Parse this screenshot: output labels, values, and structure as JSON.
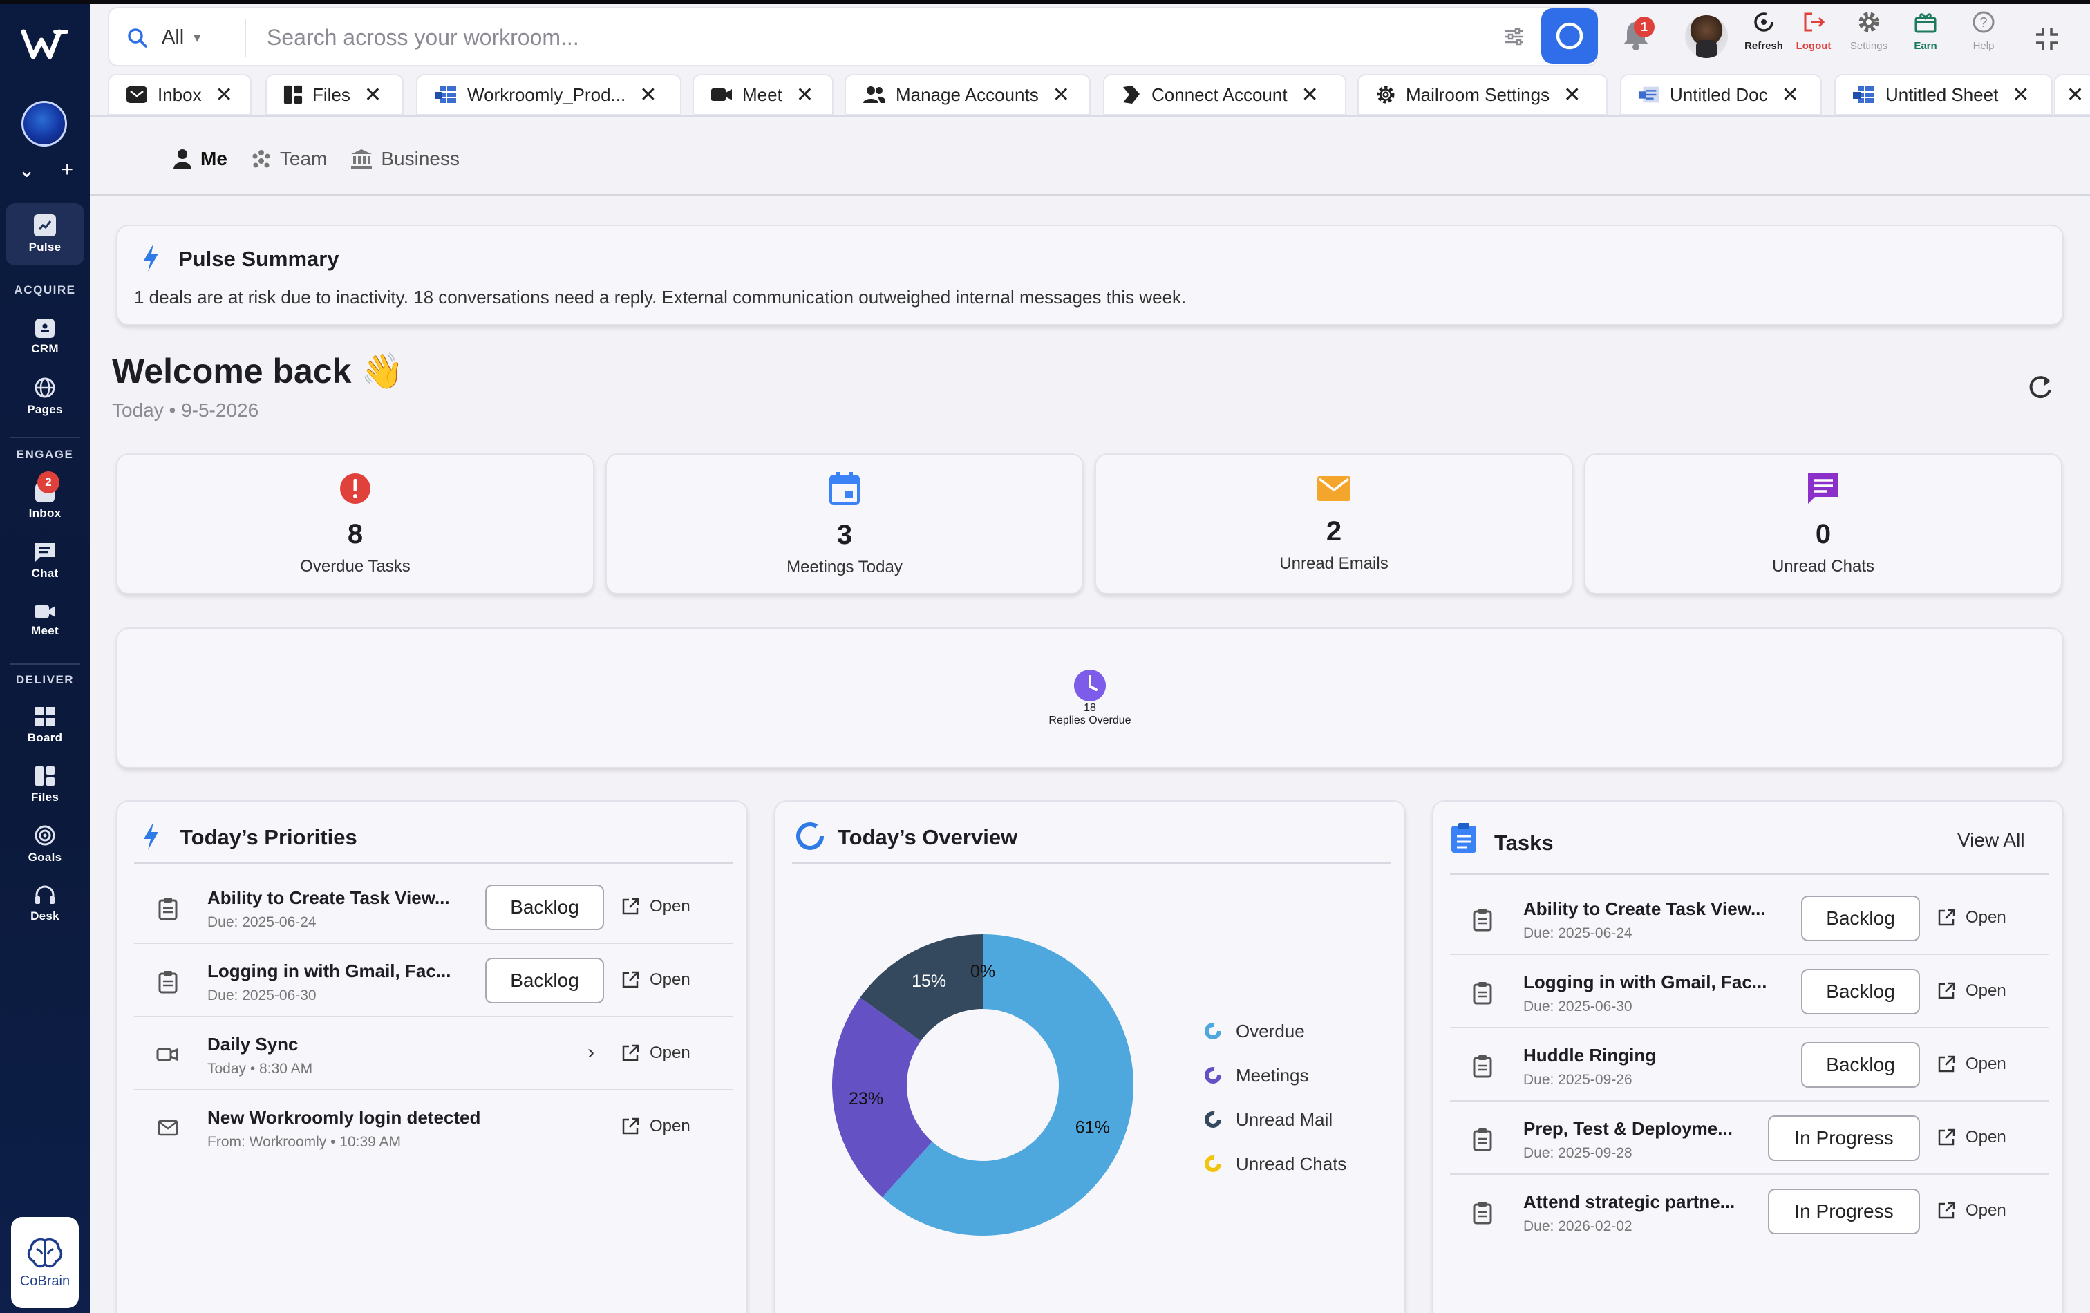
{
  "sidebar": {
    "items": {
      "pulse": "Pulse",
      "crm": "CRM",
      "pages": "Pages",
      "inbox": "Inbox",
      "chat": "Chat",
      "meet": "Meet",
      "board": "Board",
      "files": "Files",
      "goals": "Goals",
      "desk": "Desk"
    },
    "sections": {
      "acquire": "ACQUIRE",
      "engage": "ENGAGE",
      "deliver": "DELIVER"
    },
    "inbox_badge": "2",
    "cobrain": "CoBrain"
  },
  "search": {
    "scope": "All",
    "placeholder": "Search across your workroom..."
  },
  "topbar": {
    "notification_count": "1",
    "refresh": "Refresh",
    "logout": "Logout",
    "settings": "Settings",
    "earn": "Earn",
    "help": "Help"
  },
  "tabs": [
    {
      "label": "Inbox",
      "icon": "inbox-icon"
    },
    {
      "label": "Files",
      "icon": "files-icon"
    },
    {
      "label": "Workroomly_Prod...",
      "icon": "sheet-icon"
    },
    {
      "label": "Meet",
      "icon": "video-icon"
    },
    {
      "label": "Manage Accounts",
      "icon": "users-icon"
    },
    {
      "label": "Connect Account",
      "icon": "connect-icon"
    },
    {
      "label": "Mailroom Settings",
      "icon": "gear-icon"
    },
    {
      "label": "Untitled Doc",
      "icon": "doc-icon"
    },
    {
      "label": "Untitled Sheet",
      "icon": "sheet-icon"
    }
  ],
  "subnav": {
    "me": "Me",
    "team": "Team",
    "business": "Business"
  },
  "pulse": {
    "title": "Pulse Summary",
    "text": "1 deals are at risk due to inactivity. 18 conversations need a reply. External communication outweighed internal messages this week."
  },
  "welcome": {
    "title": "Welcome back 👋",
    "date": "Today • 9-5-2026"
  },
  "stats": [
    {
      "value": "8",
      "label": "Overdue Tasks",
      "color": "#e0413a"
    },
    {
      "value": "3",
      "label": "Meetings Today",
      "color": "#3b82f6"
    },
    {
      "value": "2",
      "label": "Unread Emails",
      "color": "#f3a62b"
    },
    {
      "value": "0",
      "label": "Unread Chats",
      "color": "#8b30c9"
    },
    {
      "value": "18",
      "label": "Replies Overdue",
      "color": "#7c5ce8"
    }
  ],
  "priorities": {
    "title": "Today’s Priorities",
    "open_label": "Open",
    "items": [
      {
        "title": "Ability to Create Task View...",
        "sub": "Due: 2025-06-24",
        "status": "Backlog"
      },
      {
        "title": "Logging in with Gmail, Fac...",
        "sub": "Due: 2025-06-30",
        "status": "Backlog"
      },
      {
        "title": "Daily Sync",
        "sub": "Today • 8:30 AM",
        "status": ""
      },
      {
        "title": "New Workroomly login detected",
        "sub": "From: Workroomly • 10:39 AM",
        "status": ""
      }
    ]
  },
  "overview": {
    "title": "Today’s Overview"
  },
  "chart_data": {
    "type": "pie",
    "title": "Today’s Overview",
    "categories": [
      "Overdue",
      "Meetings",
      "Unread Mail",
      "Unread Chats"
    ],
    "values": [
      61,
      23,
      15,
      0
    ],
    "labels": [
      "61%",
      "23%",
      "15%",
      "0%"
    ],
    "colors": [
      "#4fa8dd",
      "#6451c4",
      "#34495e",
      "#f1c40f"
    ],
    "legend": "right"
  },
  "tasks": {
    "title": "Tasks",
    "view_all": "View All",
    "open_label": "Open",
    "items": [
      {
        "title": "Ability to Create Task View...",
        "sub": "Due: 2025-06-24",
        "status": "Backlog"
      },
      {
        "title": "Logging in with Gmail, Fac...",
        "sub": "Due: 2025-06-30",
        "status": "Backlog"
      },
      {
        "title": "Huddle Ringing",
        "sub": "Due: 2025-09-26",
        "status": "Backlog"
      },
      {
        "title": "Prep, Test & Deployme...",
        "sub": "Due: 2025-09-28",
        "status": "In Progress"
      },
      {
        "title": "Attend strategic partne...",
        "sub": "Due: 2026-02-02",
        "status": "In Progress"
      }
    ]
  }
}
